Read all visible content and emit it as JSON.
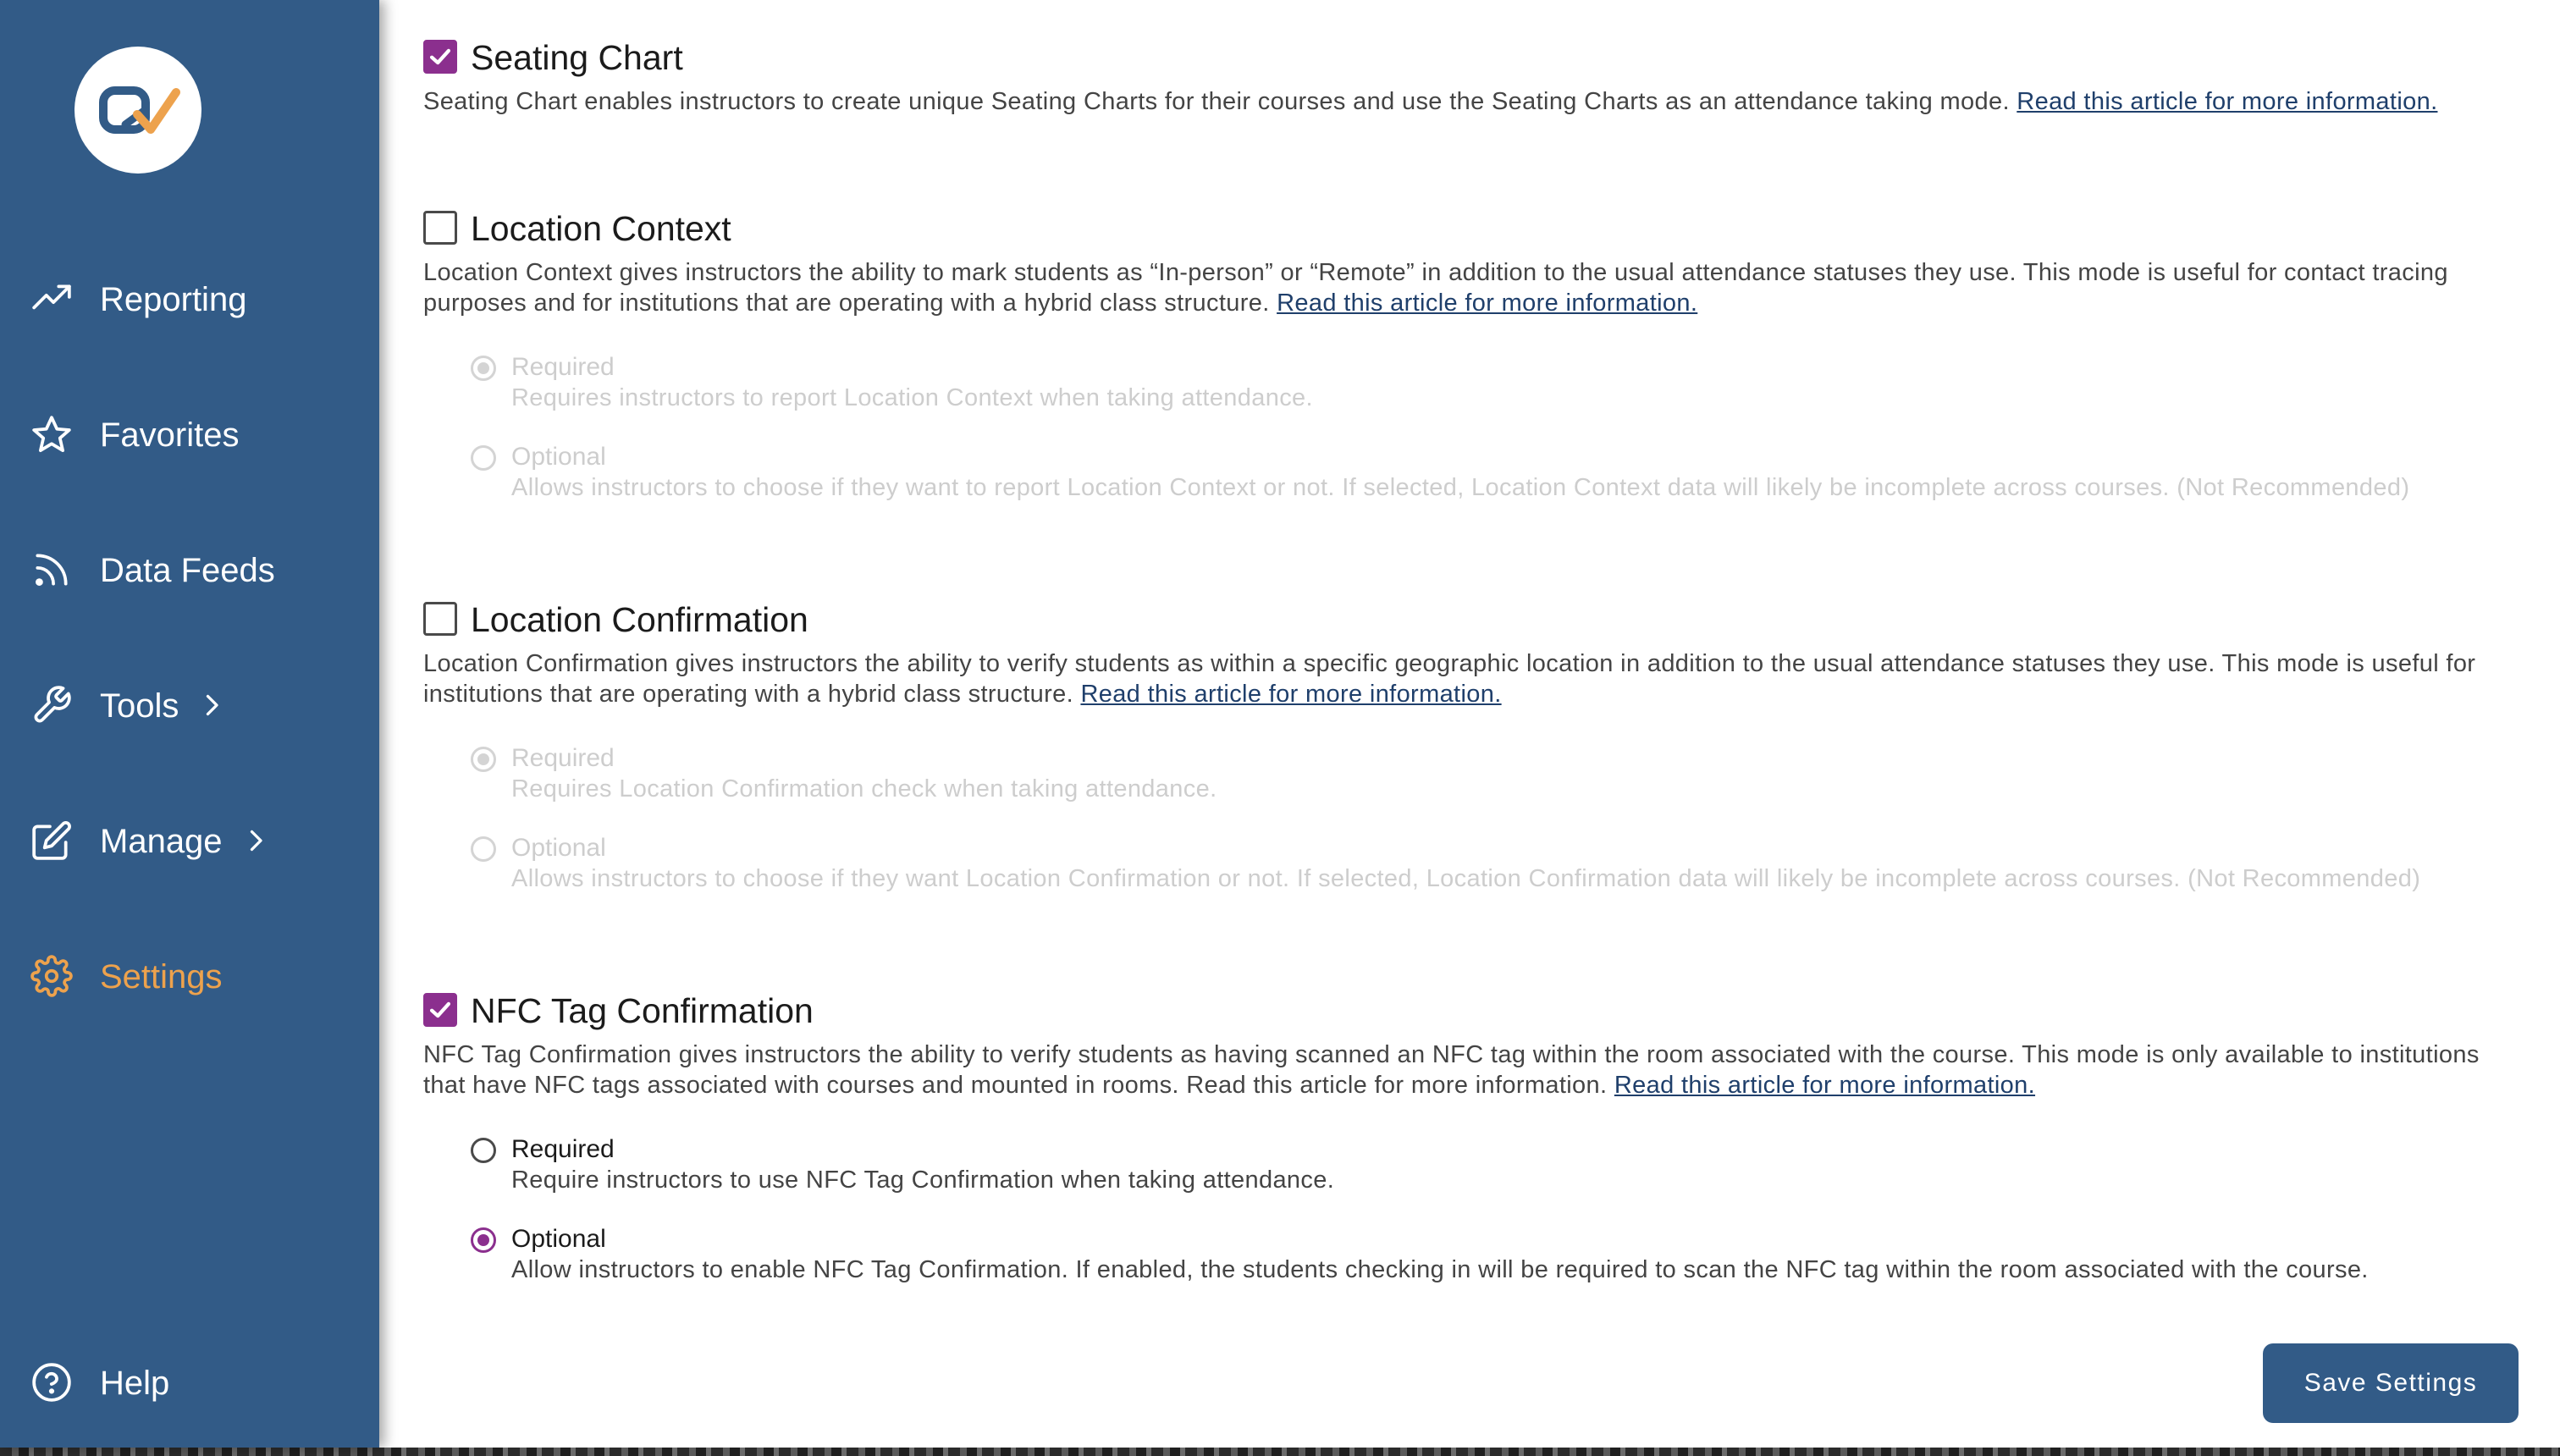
{
  "colors": {
    "sidebar_bg": "#325b87",
    "active_nav": "#eda24d",
    "checkbox_accent": "#8b2f8e",
    "link": "#1f3f6b",
    "disabled_text": "#cdcdcd"
  },
  "sidebar": {
    "logo_icon": "qwickly-check-logo",
    "items": [
      {
        "label": "Reporting",
        "icon": "trending-up-icon",
        "active": false
      },
      {
        "label": "Favorites",
        "icon": "star-icon",
        "active": false
      },
      {
        "label": "Data Feeds",
        "icon": "rss-icon",
        "active": false
      },
      {
        "label": "Tools",
        "icon": "wrench-icon",
        "active": false,
        "expandable": true
      },
      {
        "label": "Manage",
        "icon": "edit-icon",
        "active": false,
        "expandable": true
      },
      {
        "label": "Settings",
        "icon": "gear-icon",
        "active": true
      }
    ],
    "help": {
      "label": "Help",
      "icon": "help-circle-icon"
    }
  },
  "settings": {
    "seating_chart": {
      "title": "Seating Chart",
      "checked": true,
      "desc": "Seating Chart enables instructors to create unique Seating Charts for their courses and use the Seating Charts as an attendance taking mode.",
      "link": "Read this article for more information."
    },
    "location_context": {
      "title": "Location Context",
      "checked": false,
      "desc": "Location Context gives instructors the ability to mark students as “In-person” or “Remote” in addition to the usual attendance statuses they use. This mode is useful for contact tracing purposes and for institutions that are operating with a hybrid class structure.",
      "link": "Read this article for more information.",
      "options": [
        {
          "title": "Required",
          "desc": "Requires instructors to report Location Context when taking attendance.",
          "selected": true,
          "disabled": true
        },
        {
          "title": "Optional",
          "desc": "Allows instructors to choose if they want to report Location Context or not. If selected, Location Context data will likely be incomplete across courses. (Not Recommended)",
          "selected": false,
          "disabled": true
        }
      ]
    },
    "location_confirmation": {
      "title": "Location Confirmation",
      "checked": false,
      "desc": "Location Confirmation gives instructors the ability to verify students as within a specific geographic location in addition to the usual attendance statuses they use. This mode is useful for institutions that are operating with a hybrid class structure.",
      "link": "Read this article for more information.",
      "options": [
        {
          "title": "Required",
          "desc": "Requires Location Confirmation check when taking attendance.",
          "selected": true,
          "disabled": true
        },
        {
          "title": "Optional",
          "desc": "Allows instructors to choose if they want Location Confirmation or not. If selected, Location Confirmation data will likely be incomplete across courses. (Not Recommended)",
          "selected": false,
          "disabled": true
        }
      ]
    },
    "nfc_tag": {
      "title": "NFC Tag Confirmation",
      "checked": true,
      "desc": "NFC Tag Confirmation gives instructors the ability to verify students as having scanned an NFC tag within the room associated with the course. This mode is only available to institutions that have NFC tags associated with courses and mounted in rooms. Read this article for more information.",
      "link": "Read this article for more information.",
      "options": [
        {
          "title": "Required",
          "desc": "Require instructors to use NFC Tag Confirmation when taking attendance.",
          "selected": false,
          "disabled": false
        },
        {
          "title": "Optional",
          "desc": "Allow instructors to enable NFC Tag Confirmation. If enabled, the students checking in will be required to scan the NFC tag within the room associated with the course.",
          "selected": true,
          "disabled": false
        }
      ]
    }
  },
  "save_button": "Save Settings"
}
